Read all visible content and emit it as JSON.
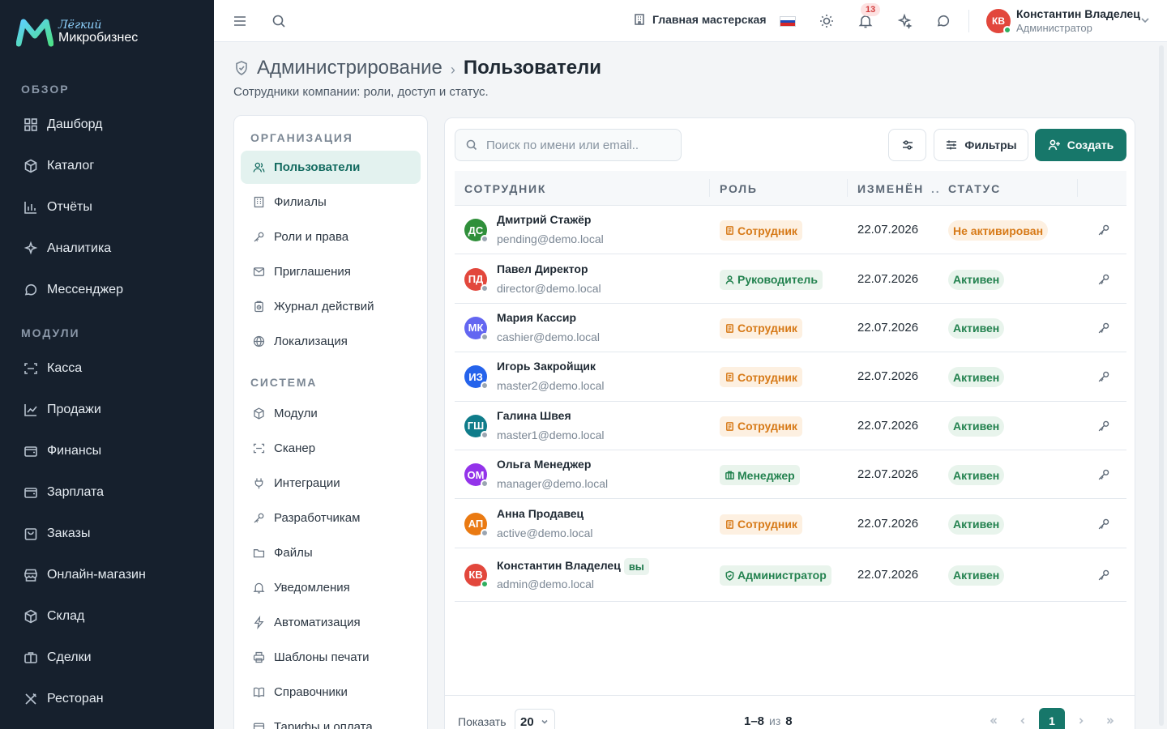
{
  "brand": {
    "top": "Лёгкий",
    "bottom": "Микробизнес"
  },
  "sidebar": {
    "sections": [
      {
        "title": "ОБЗОР",
        "items": [
          {
            "label": "Дашборд",
            "icon": "grid-icon"
          },
          {
            "label": "Каталог",
            "icon": "box-icon"
          },
          {
            "label": "Отчёты",
            "icon": "bar-chart-icon"
          },
          {
            "label": "Аналитика",
            "icon": "sparkle-icon"
          },
          {
            "label": "Мессенджер",
            "icon": "chat-icon"
          }
        ]
      },
      {
        "title": "МОДУЛИ",
        "items": [
          {
            "label": "Касса",
            "icon": "scan-icon"
          },
          {
            "label": "Продажи",
            "icon": "trend-icon"
          },
          {
            "label": "Финансы",
            "icon": "wallet-icon"
          },
          {
            "label": "Зарплата",
            "icon": "wallet-icon"
          },
          {
            "label": "Заказы",
            "icon": "bag-icon"
          },
          {
            "label": "Онлайн-магазин",
            "icon": "store-icon"
          },
          {
            "label": "Склад",
            "icon": "box-icon"
          },
          {
            "label": "Сделки",
            "icon": "briefcase-icon"
          },
          {
            "label": "Ресторан",
            "icon": "cutlery-icon"
          }
        ]
      }
    ]
  },
  "topbar": {
    "workspace": "Главная мастерская",
    "notifications_count": "13",
    "user": {
      "initials": "КВ",
      "name": "Константин Владелец",
      "role": "Администратор"
    }
  },
  "page": {
    "breadcrumb_parent": "Администрирование",
    "breadcrumb_sep": "›",
    "title": "Пользователи",
    "subtitle": "Сотрудники компании: роли, доступ и статус."
  },
  "subnav": {
    "sections": [
      {
        "title": "ОРГАНИЗАЦИЯ",
        "items": [
          {
            "label": "Пользователи",
            "icon": "users-icon",
            "active": true
          },
          {
            "label": "Филиалы",
            "icon": "building-icon"
          },
          {
            "label": "Роли и права",
            "icon": "key-icon"
          },
          {
            "label": "Приглашения",
            "icon": "mail-icon"
          },
          {
            "label": "Журнал действий",
            "icon": "clipboard-icon"
          },
          {
            "label": "Локализация",
            "icon": "globe-icon"
          }
        ]
      },
      {
        "title": "СИСТЕМА",
        "items": [
          {
            "label": "Модули",
            "icon": "box-icon"
          },
          {
            "label": "Сканер",
            "icon": "scan-icon"
          },
          {
            "label": "Интеграции",
            "icon": "plug-icon"
          },
          {
            "label": "Разработчикам",
            "icon": "key-icon"
          },
          {
            "label": "Файлы",
            "icon": "folder-icon"
          },
          {
            "label": "Уведомления",
            "icon": "bell-icon"
          },
          {
            "label": "Автоматизация",
            "icon": "bolt-icon"
          },
          {
            "label": "Шаблоны печати",
            "icon": "printer-icon"
          },
          {
            "label": "Справочники",
            "icon": "book-icon"
          },
          {
            "label": "Тарифы и оплата",
            "icon": "card-icon"
          }
        ]
      }
    ]
  },
  "toolbar": {
    "search_placeholder": "Поиск по имени или email..",
    "filters_label": "Фильтры",
    "create_label": "Создать"
  },
  "table": {
    "columns": [
      "СОТРУДНИК",
      "РОЛЬ",
      "ИЗМЕНЁН",
      "..",
      "СТАТУС"
    ],
    "rows": [
      {
        "initials": "ДС",
        "color": "#2f8f3a",
        "online": false,
        "name": "Дмитрий Стажёр",
        "email": "pending@demo.local",
        "role": "Сотрудник",
        "role_kind": "emp",
        "date": "22.07.2026",
        "status": "Не активирован",
        "status_kind": "pend"
      },
      {
        "initials": "ПД",
        "color": "#e2473c",
        "online": false,
        "name": "Павел Директор",
        "email": "director@demo.local",
        "role": "Руководитель",
        "role_kind": "lead",
        "date": "22.07.2026",
        "status": "Активен",
        "status_kind": "ok"
      },
      {
        "initials": "МК",
        "color": "#6366f1",
        "online": false,
        "name": "Мария Кассир",
        "email": "cashier@demo.local",
        "role": "Сотрудник",
        "role_kind": "emp",
        "date": "22.07.2026",
        "status": "Активен",
        "status_kind": "ok"
      },
      {
        "initials": "ИЗ",
        "color": "#2563eb",
        "online": false,
        "name": "Игорь Закройщик",
        "email": "master2@demo.local",
        "role": "Сотрудник",
        "role_kind": "emp",
        "date": "22.07.2026",
        "status": "Активен",
        "status_kind": "ok"
      },
      {
        "initials": "ГШ",
        "color": "#0f7c8a",
        "online": false,
        "name": "Галина Швея",
        "email": "master1@demo.local",
        "role": "Сотрудник",
        "role_kind": "emp",
        "date": "22.07.2026",
        "status": "Активен",
        "status_kind": "ok"
      },
      {
        "initials": "ОМ",
        "color": "#9333ea",
        "online": false,
        "name": "Ольга Менеджер",
        "email": "manager@demo.local",
        "role": "Менеджер",
        "role_kind": "mgr",
        "date": "22.07.2026",
        "status": "Активен",
        "status_kind": "ok"
      },
      {
        "initials": "АП",
        "color": "#ea7a12",
        "online": false,
        "name": "Анна Продавец",
        "email": "active@demo.local",
        "role": "Сотрудник",
        "role_kind": "emp",
        "date": "22.07.2026",
        "status": "Активен",
        "status_kind": "ok"
      },
      {
        "initials": "КВ",
        "color": "#e2473c",
        "online": true,
        "name": "Константин Владелец",
        "you_badge": "вы",
        "email": "admin@demo.local",
        "role": "Администратор",
        "role_kind": "admin",
        "date": "22.07.2026",
        "status": "Активен",
        "status_kind": "ok"
      }
    ]
  },
  "footer": {
    "show_label": "Показать",
    "page_size": "20",
    "range": "1–8",
    "of_label": "из",
    "total": "8",
    "current_page": "1"
  }
}
